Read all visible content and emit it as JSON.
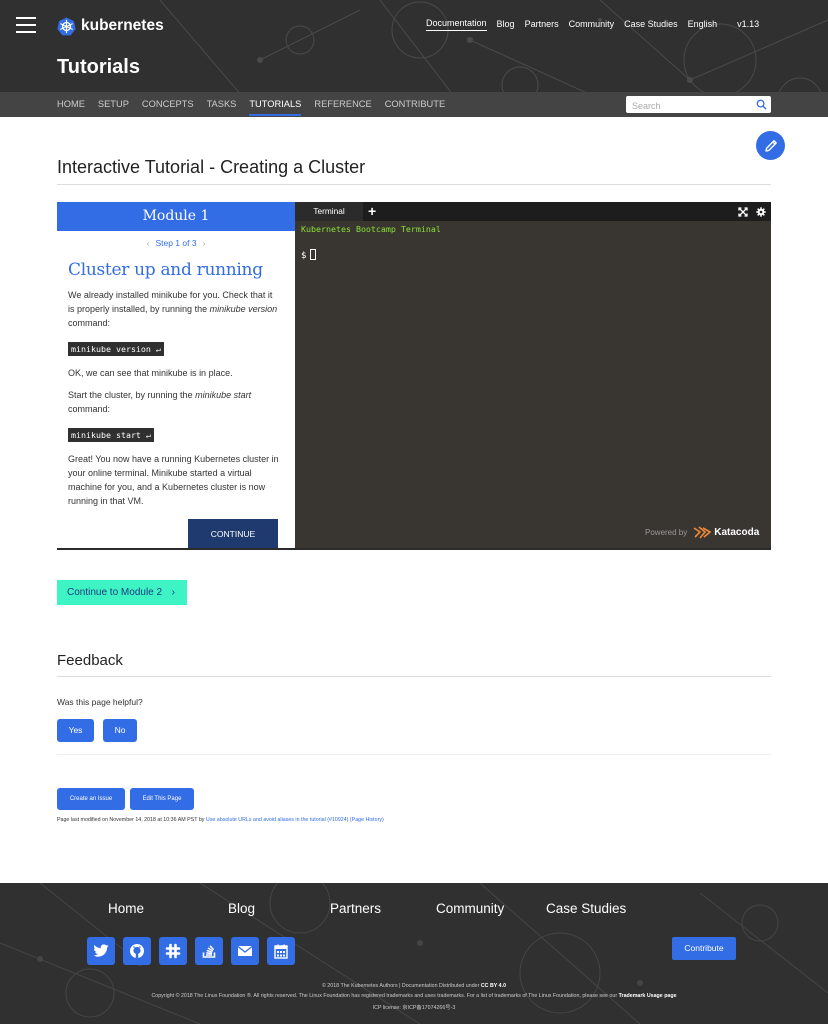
{
  "brand": {
    "name": "kubernetes",
    "accent": "#326de6"
  },
  "topnav": {
    "items": [
      "Documentation",
      "Blog",
      "Partners",
      "Community",
      "Case Studies",
      "English"
    ],
    "version": "v1.13"
  },
  "page": {
    "title": "Tutorials"
  },
  "subnav": {
    "items": [
      "HOME",
      "SETUP",
      "CONCEPTS",
      "TASKS",
      "TUTORIALS",
      "REFERENCE",
      "CONTRIBUTE"
    ]
  },
  "search": {
    "placeholder": "Search"
  },
  "main": {
    "title": "Interactive Tutorial - Creating a Cluster"
  },
  "tutorial": {
    "module": "Module 1",
    "step": "Step 1 of 3",
    "heading": "Cluster up and running",
    "p1a": "We already installed minikube for you. Check that it is properly installed, by running the ",
    "p1em": "minikube version",
    "p1b": " command:",
    "code1": "minikube version ↵",
    "p2": "OK, we can see that minikube is in place.",
    "p3a": "Start the cluster, by running the ",
    "p3em": "minikube start",
    "p3b": " command:",
    "code2": "minikube start ↵",
    "p4": "Great! You now have a running Kubernetes cluster in your online terminal. Minikube started a virtual machine for you, and a Kubernetes cluster is now running in that VM.",
    "continue": "CONTINUE"
  },
  "terminal": {
    "tab": "Terminal",
    "plus": "+",
    "banner": "Kubernetes Bootcamp Terminal",
    "prompt": "$",
    "powered": "Powered by",
    "provider": "Katacoda"
  },
  "next": {
    "label": "Continue to Module 2",
    "chevron": "›"
  },
  "feedback": {
    "title": "Feedback",
    "question": "Was this page helpful?",
    "yes": "Yes",
    "no": "No"
  },
  "actions": {
    "issue": "Create an Issue",
    "edit": "Edit This Page"
  },
  "modified": {
    "prefix": "Page last modified on November 14, 2018 at 10:36 AM PST by ",
    "commit": "Use absolute URLs and avoid aliases in the tutorial (#10924)",
    "history": "(Page History)"
  },
  "footer": {
    "nav": [
      "Home",
      "Blog",
      "Partners",
      "Community",
      "Case Studies"
    ],
    "social_icons": [
      "twitter-icon",
      "github-icon",
      "slack-icon",
      "stackoverflow-icon",
      "mail-icon",
      "calendar-icon"
    ],
    "contribute": "Contribute",
    "line1a": "© 2018 The Kubernetes Authors | Documentation Distributed under ",
    "line1b": "CC BY 4.0",
    "line2a": "Copyright © 2018 The Linux Foundation ®. All rights reserved. The Linux Foundation has registered trademarks and uses trademarks. For a list of trademarks of The Linux Foundation, please see our ",
    "line2b": "Trademark Usage page",
    "line3": "ICP license: 京ICP备17074266号-3"
  }
}
